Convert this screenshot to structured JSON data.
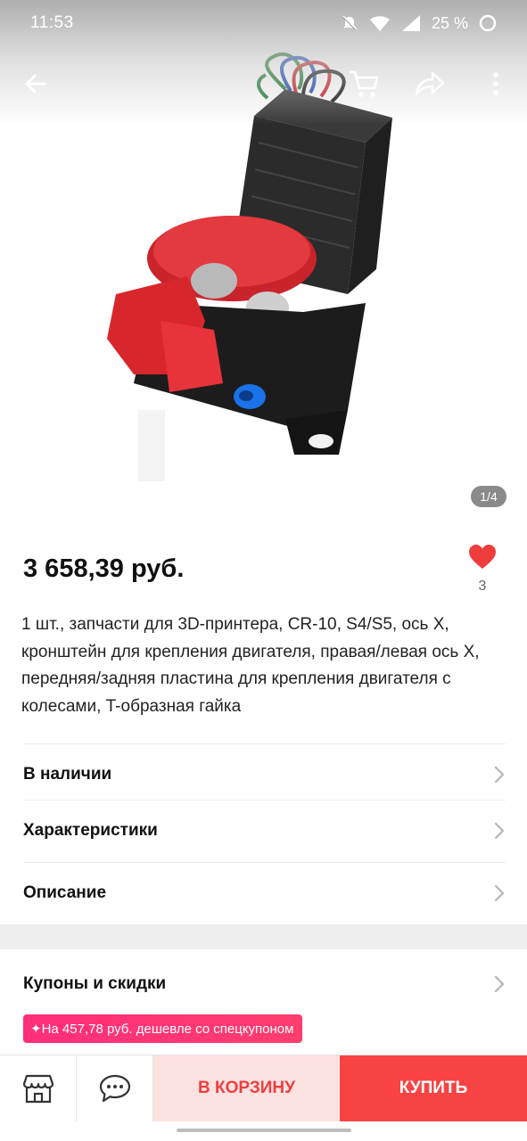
{
  "status_bar": {
    "time": "11:53",
    "battery": "25 %"
  },
  "nav": {
    "back_icon": "arrow-left-icon",
    "cart_icon": "cart-icon",
    "share_icon": "share-icon",
    "more_icon": "more-vertical-icon"
  },
  "gallery": {
    "page_indicator": "1/4"
  },
  "product": {
    "price": "3 658,39 руб.",
    "favorites_count": "3",
    "title": "1 шт., запчасти для 3D-принтера, CR-10, S4/S5, ось X, кронштейн для крепления двигателя, правая/левая ось X, передняя/задняя пластина для крепления двигателя с колесами, T-образная гайка"
  },
  "rows": {
    "stock": "В наличии",
    "specs": "Характеристики",
    "description": "Описание",
    "coupons": "Купоны и скидки"
  },
  "coupon_badge": "✦На 457,78 руб. дешевле со спецкупоном",
  "bottom_bar": {
    "store_icon": "store-icon",
    "chat_icon": "chat-icon",
    "add_to_cart": "В КОРЗИНУ",
    "buy": "КУПИТЬ"
  },
  "colors": {
    "accent_red": "#f74343",
    "cart_bg": "#fde2e2",
    "coupon_pink": "#ff2e7a",
    "heart_red": "#ef3d3d"
  }
}
